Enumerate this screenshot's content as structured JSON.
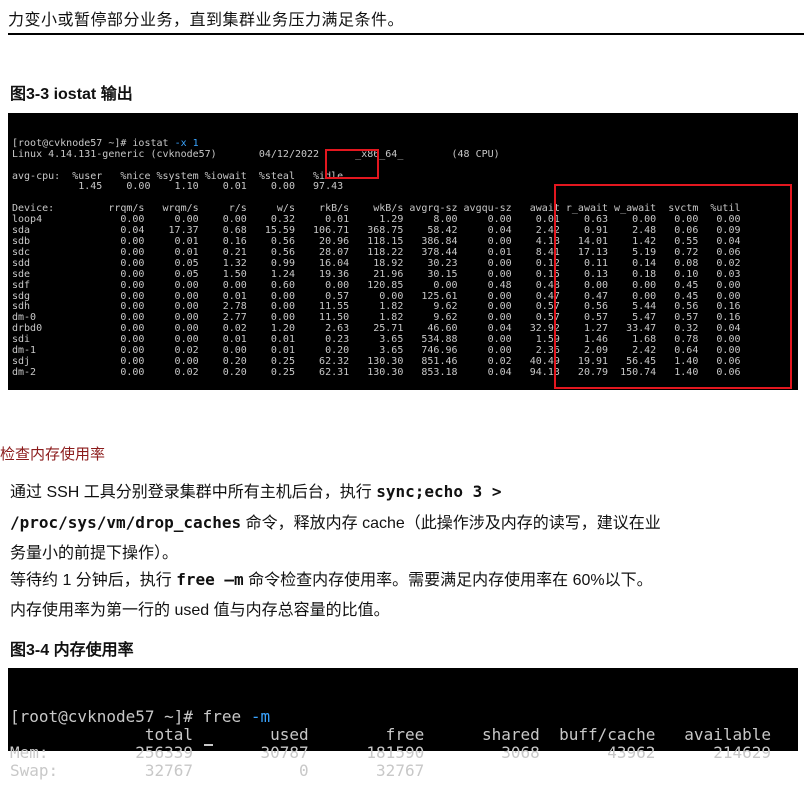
{
  "top_text": "力变小或暂停部分业务，直到集群业务压力满足条件。",
  "figure_3_3": {
    "caption": "图3-3 iostat 输出",
    "prompt_line_pre": "[root@cvknode57 ~]# iostat ",
    "prompt_line_arg": "-x 1",
    "lines": [
      "Linux 4.14.131-generic (cvknode57)       04/12/2022      _x86_64_        (48 CPU)",
      "",
      "avg-cpu:  %user   %nice %system %iowait  %steal   %idle",
      "           1.45    0.00    1.10    0.01    0.00   97.43",
      "",
      "Device:         rrqm/s   wrqm/s     r/s     w/s    rkB/s    wkB/s avgrq-sz avgqu-sz   await r_await w_await  svctm  %util",
      "loop4             0.00     0.00    0.00    0.32     0.01     1.29     8.00     0.00    0.01    0.63    0.00   0.00   0.00",
      "sda               0.04    17.37    0.68   15.59   106.71   368.75    58.42     0.04    2.42    0.91    2.48   0.06   0.09",
      "sdb               0.00     0.01    0.16    0.56    20.96   118.15   386.84     0.00    4.18   14.01    1.42   0.55   0.04",
      "sdc               0.00     0.01    0.21    0.56    28.07   118.22   378.44     0.01    8.41   17.13    5.19   0.72   0.06",
      "sdd               0.00     0.05    1.32    0.99    16.04    18.92    30.23     0.00    0.12    0.11    0.14   0.08   0.02",
      "sde               0.00     0.05    1.50    1.24    19.36    21.96    30.15     0.00    0.15    0.13    0.18   0.10   0.03",
      "sdf               0.00     0.00    0.00    0.60     0.00   120.85     0.00     0.48    0.48    0.00    0.00   0.45   0.00",
      "sdg               0.00     0.00    0.01    0.00     0.57     0.00   125.61     0.00    0.47    0.47    0.00   0.45   0.00",
      "sdh               0.00     0.00    2.78    0.00    11.55     1.82     9.62     0.00    0.57    0.56    5.44   0.56   0.16",
      "dm-0              0.00     0.00    2.77    0.00    11.50     1.82     9.62     0.00    0.57    0.57    5.47   0.57   0.16",
      "drbd0             0.00     0.00    0.02    1.20     2.63    25.71    46.60     0.04   32.92    1.27   33.47   0.32   0.04",
      "sdi               0.00     0.00    0.01    0.01     0.23     3.65   534.88     0.00    1.59    1.46    1.68   0.78   0.00",
      "dm-1              0.00     0.02    0.00    0.01     0.20     3.65   746.96     0.00    2.36    2.09    2.42   0.64   0.00",
      "sdj               0.00     0.00    0.20    0.25    62.32   130.30   851.46     0.02   40.49   19.91   56.45   1.40   0.06",
      "dm-2              0.00     0.02    0.20    0.25    62.31   130.30   853.18     0.04   94.13   20.79  150.74   1.40   0.06"
    ]
  },
  "section_title": "检查内存使用率",
  "paragraph_1": {
    "text_1": "通过 SSH 工具分别登录集群中所有主机后台，执行 ",
    "code_1": "sync;echo 3 >",
    "code_2": "/proc/sys/vm/drop_caches",
    "text_2": " 命令，释放内存 cache（此操作涉及内存的读写，建议在业",
    "text_3": "务量小的前提下操作）。"
  },
  "paragraph_2": {
    "text_1": "等待约 1 分钟后，执行 ",
    "code_1": "free –m",
    "text_2": " 命令检查内存使用率。需要满足内存使用率在 60%以下。",
    "text_3": "内存使用率为第一行的 used 值与内存总容量的比值。"
  },
  "figure_3_4": {
    "caption": "图3-4 内存使用率",
    "prompt_pre": "[root@cvknode57 ~]# free ",
    "prompt_arg": "-m",
    "lines": [
      "              total        used        free      shared  buff/cache   available",
      "Mem:         256339       30787      181590        3068       43962      214629",
      "Swap:         32767           0       32767"
    ]
  },
  "colors": {
    "highlight_box": "#e3171f",
    "terminal_bg": "#000000",
    "terminal_fg": "#c8c8c8",
    "arg_color": "#3aa4ff",
    "section_color": "#8b1a1a"
  }
}
